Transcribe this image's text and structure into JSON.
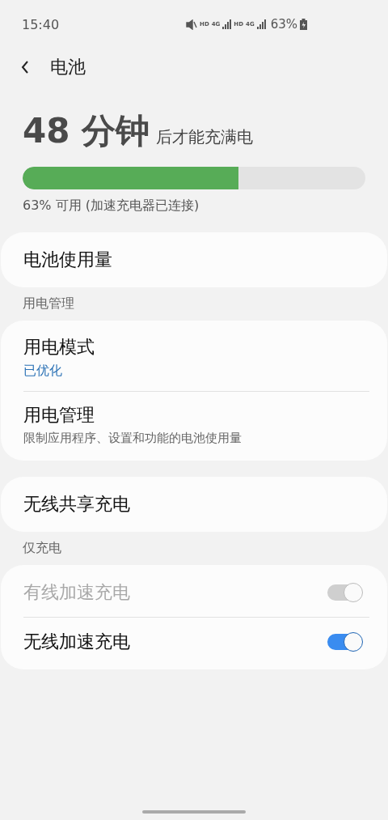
{
  "status_bar": {
    "time": "15:40",
    "network_labels": [
      "HD",
      "4G",
      "HD",
      "4G"
    ],
    "battery_percent": "63%"
  },
  "header": {
    "title": "电池"
  },
  "charge": {
    "time_value": "48 分钟",
    "time_suffix": "后才能充满电",
    "level": 0.63,
    "status": "63% 可用 (加速充电器已连接)"
  },
  "groups": [
    {
      "items": [
        {
          "title": "电池使用量"
        }
      ]
    },
    {
      "heading": "用电管理",
      "items": [
        {
          "title": "用电模式",
          "value": "已优化"
        },
        {
          "title": "用电管理",
          "subtitle": "限制应用程序、设置和功能的电池使用量"
        }
      ]
    },
    {
      "items": [
        {
          "title": "无线共享充电"
        }
      ]
    },
    {
      "heading": "仅充电",
      "items": [
        {
          "title": "有线加速充电",
          "kind": "switch",
          "on": true,
          "disabled": true
        },
        {
          "title": "无线加速充电",
          "kind": "switch",
          "on": true,
          "disabled": false
        }
      ]
    }
  ]
}
